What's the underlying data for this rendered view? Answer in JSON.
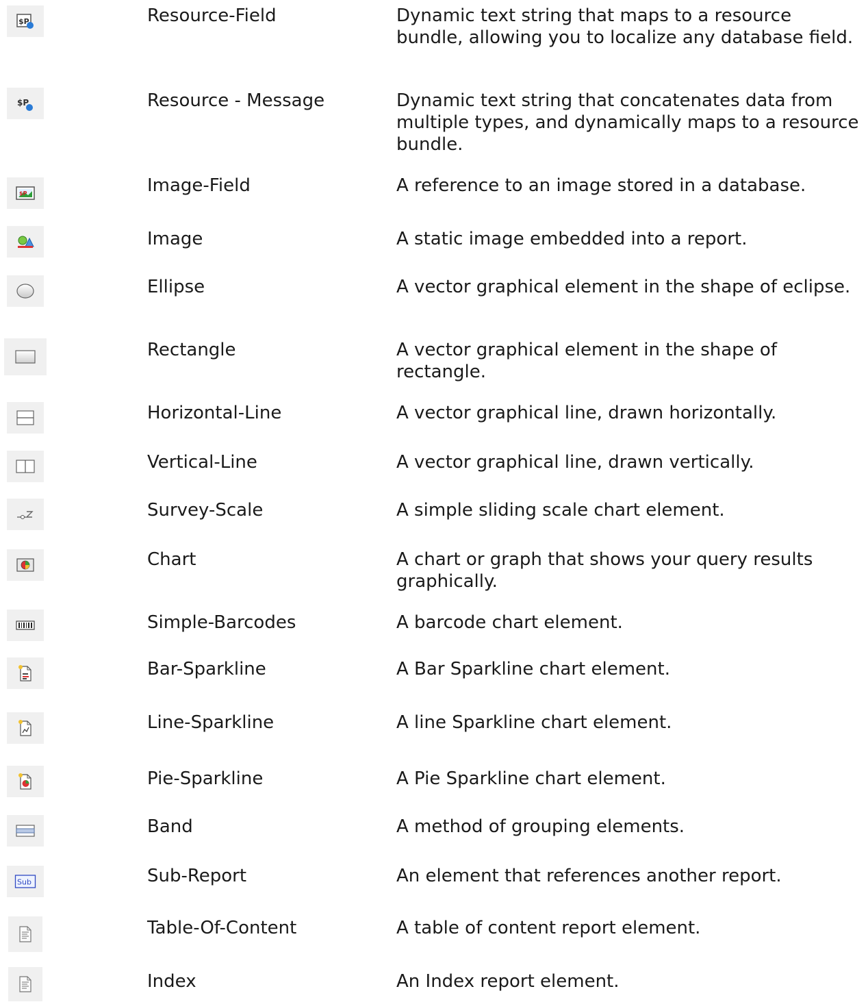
{
  "rows": [
    {
      "icon": "resource-field-icon",
      "name": "Resource-Field",
      "desc": "Dynamic text string that maps to a resource bundle, allowing you to localize any database field."
    },
    {
      "icon": "resource-message-icon",
      "name": "Resource - Message",
      "desc": "Dynamic text string that concatenates data from multiple types, and dynamically maps to a resource bundle."
    },
    {
      "icon": "image-field-icon",
      "name": "Image-Field",
      "desc": "A reference to an image stored in a database."
    },
    {
      "icon": "image-icon",
      "name": "Image",
      "desc": "A static image embedded into a report."
    },
    {
      "icon": "ellipse-icon",
      "name": "Ellipse",
      "desc": "A vector graphical element in the shape of eclipse."
    },
    {
      "icon": "rectangle-icon",
      "name": "Rectangle",
      "desc": "A vector graphical element in the shape of rectangle."
    },
    {
      "icon": "horizontal-line-icon",
      "name": "Horizontal-Line",
      "desc": "A vector graphical line, drawn horizontally."
    },
    {
      "icon": "vertical-line-icon",
      "name": "Vertical-Line",
      "desc": "A vector graphical line, drawn vertically."
    },
    {
      "icon": "survey-scale-icon",
      "name": "Survey-Scale",
      "desc": "A simple sliding scale chart element."
    },
    {
      "icon": "chart-icon",
      "name": "Chart",
      "desc": "A chart or graph that shows your query results graphically."
    },
    {
      "icon": "barcode-icon",
      "name": "Simple-Barcodes",
      "desc": "A barcode chart element."
    },
    {
      "icon": "bar-sparkline-icon",
      "name": "Bar-Sparkline",
      "desc": "A Bar Sparkline chart element."
    },
    {
      "icon": "line-sparkline-icon",
      "name": "Line-Sparkline",
      "desc": "A line Sparkline chart element."
    },
    {
      "icon": "pie-sparkline-icon",
      "name": "Pie-Sparkline",
      "desc": "A Pie Sparkline chart element."
    },
    {
      "icon": "band-icon",
      "name": "Band",
      "desc": "A method of grouping elements."
    },
    {
      "icon": "sub-report-icon",
      "name": "Sub-Report",
      "desc": "An element that references another report."
    },
    {
      "icon": "table-of-content-icon",
      "name": "Table-Of-Content",
      "desc": "A table of content report element."
    },
    {
      "icon": "index-icon",
      "name": "Index",
      "desc": "An Index report element."
    }
  ],
  "sub_report_icon_text": "Sub"
}
